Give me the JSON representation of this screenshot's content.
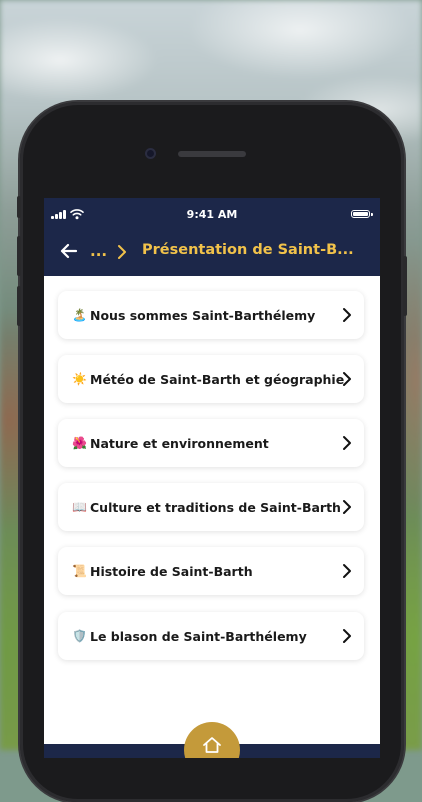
{
  "status_bar": {
    "time": "9:41 AM"
  },
  "nav": {
    "ellipsis": "...",
    "title": "Présentation de Saint-B..."
  },
  "items": [
    {
      "emoji": "🏝️",
      "label": "Nous sommes Saint-Barthélemy"
    },
    {
      "emoji": "☀️",
      "label": "Météo de Saint-Barth et géographie"
    },
    {
      "emoji": "🌺",
      "label": "Nature et environnement"
    },
    {
      "emoji": "📖",
      "label": "Culture et traditions de Saint-Barth"
    },
    {
      "emoji": "📜",
      "label": "Histoire de Saint-Barth"
    },
    {
      "emoji": "🛡️",
      "label": "Le blason de Saint-Barthélemy"
    }
  ],
  "colors": {
    "header": "#1c2749",
    "accent": "#f1c24a",
    "home_button": "#c49a3a"
  }
}
